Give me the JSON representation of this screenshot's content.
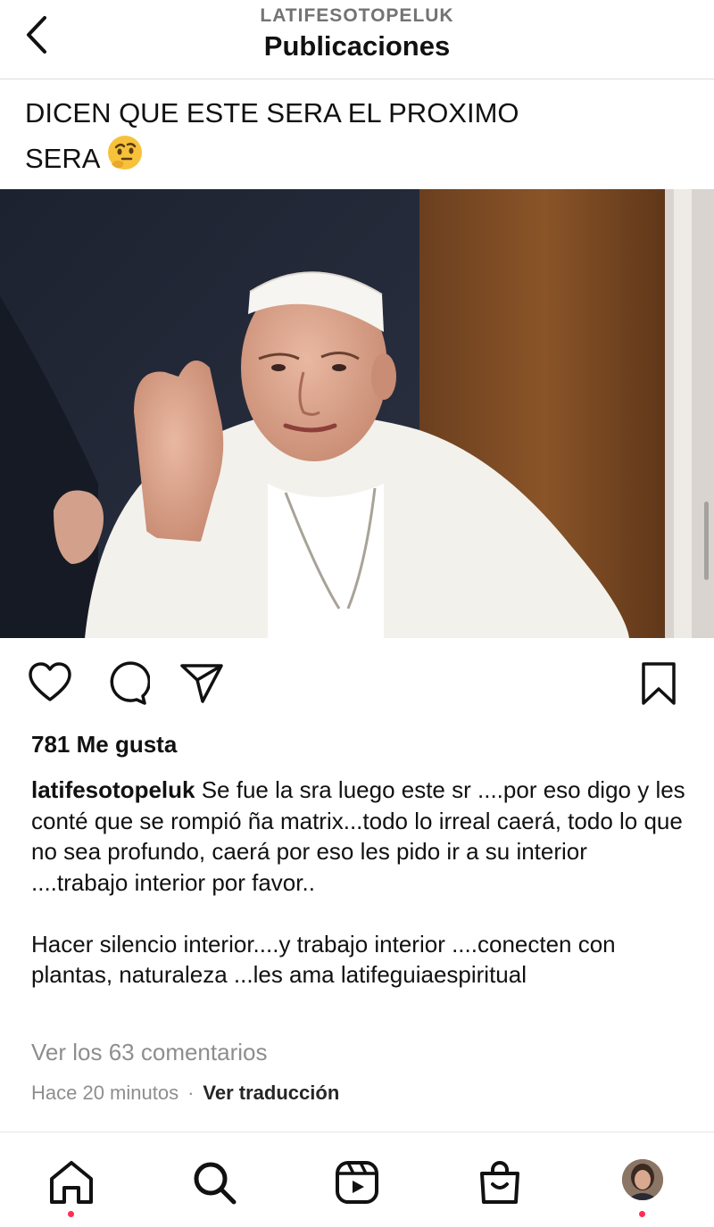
{
  "header": {
    "username": "LATIFESOTOPELUK",
    "title": "Publicaciones"
  },
  "post": {
    "image_text_line1": "DICEN QUE ESTE SERA EL PROXIMO",
    "image_text_line2": "SERA",
    "image_emoji": "thinking-face",
    "likes": "781 Me gusta",
    "author": "latifesotopeluk",
    "caption_p1": "Se fue la sra luego este sr ....por eso digo y les conté que se rompió ña matrix...todo lo irreal caerá, todo lo que no sea profundo, caerá por eso les pido ir a su interior ....trabajo interior por favor..",
    "caption_p2": "Hacer silencio interior....y trabajo interior ....conecten con plantas, naturaleza ...les ama latifeguiaespiritual",
    "view_comments": "Ver los 63 comentarios",
    "time": "Hace 20 minutos",
    "separator": "·",
    "translate": "Ver traducción"
  },
  "icons": {
    "back": "chevron-left-icon",
    "like": "heart-icon",
    "comment": "comment-bubble-icon",
    "share": "paper-plane-icon",
    "save": "bookmark-icon",
    "home": "home-icon",
    "search": "search-icon",
    "reels": "reels-icon",
    "shop": "shopping-bag-icon",
    "profile": "profile-avatar"
  },
  "colors": {
    "notification_dot": "#ff2d55",
    "muted_text": "#8e8e8e"
  }
}
